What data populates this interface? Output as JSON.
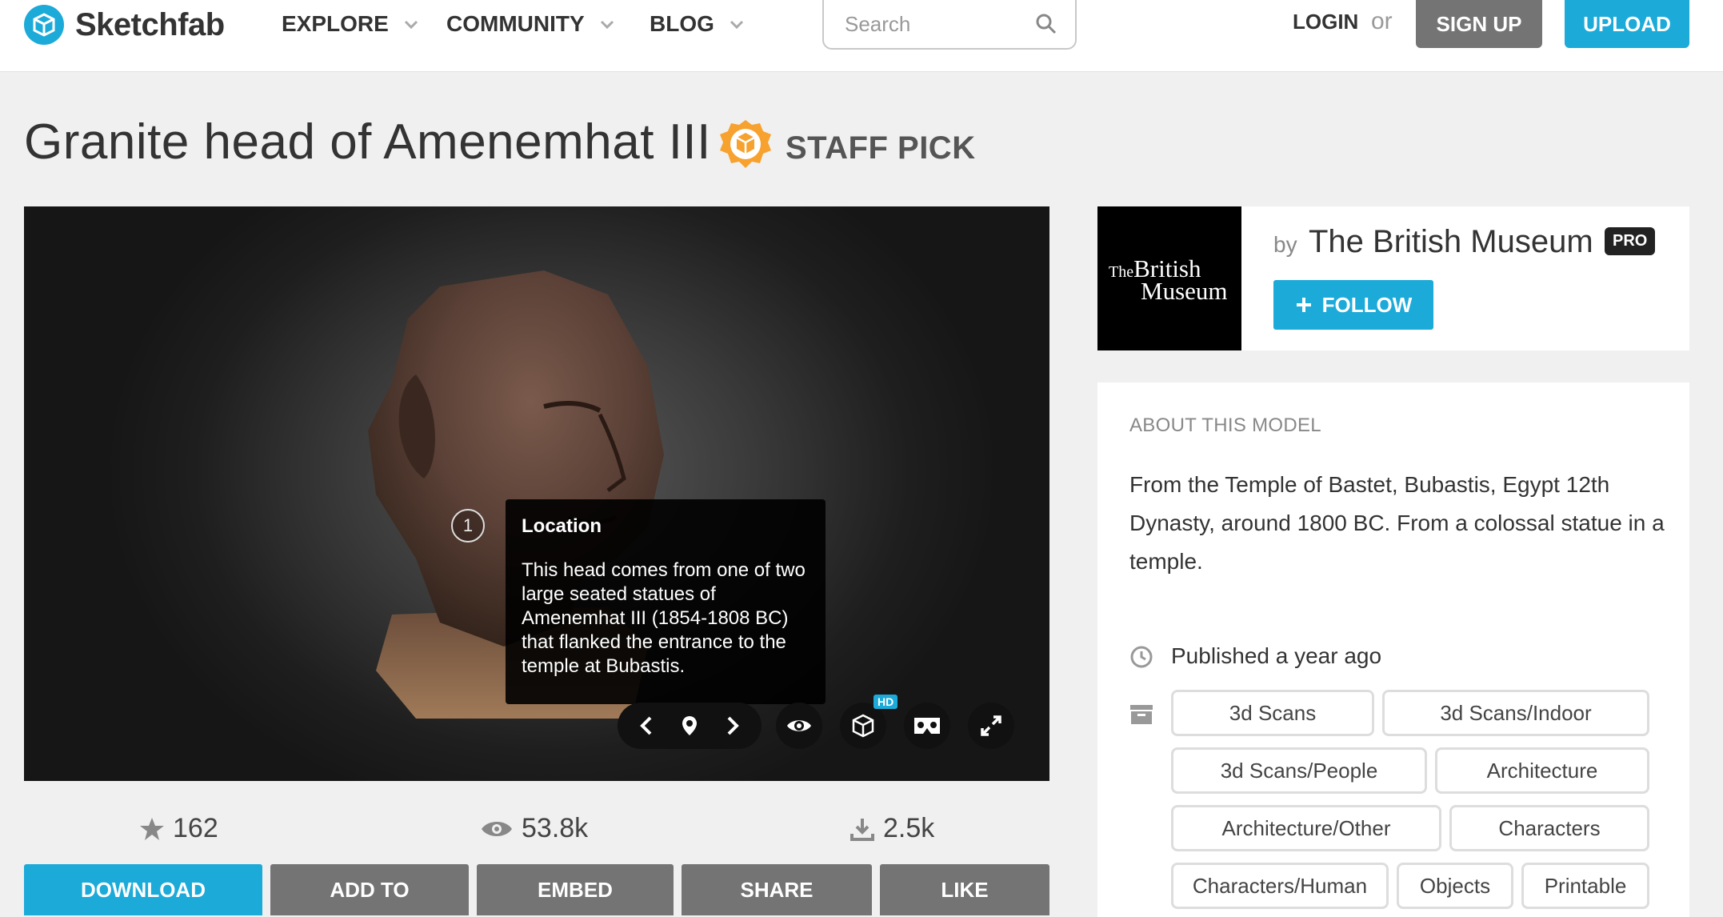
{
  "header": {
    "brand": "Sketchfab",
    "nav": [
      {
        "label": "EXPLORE"
      },
      {
        "label": "COMMUNITY"
      },
      {
        "label": "BLOG"
      }
    ],
    "search_placeholder": "Search",
    "login": "LOGIN",
    "or": "or",
    "signup": "SIGN UP",
    "upload": "UPLOAD"
  },
  "model": {
    "title": "Granite head of Amenemhat III",
    "staff_pick": "STAFF PICK"
  },
  "viewer": {
    "hotspot_number": "1",
    "annotation_title": "Location",
    "annotation_body": "This head comes from one of two large seated statues of Amenemhat III (1854-1808 BC) that flanked the entrance to the temple at Bubastis.",
    "hd_badge": "HD"
  },
  "stats": {
    "likes": "162",
    "views": "53.8k",
    "downloads": "2.5k"
  },
  "actions": {
    "download": "DOWNLOAD",
    "add_to": "ADD TO",
    "embed": "EMBED",
    "share": "SHARE",
    "like": "LIKE"
  },
  "author": {
    "logo_line1_small": "The",
    "logo_line1": "British",
    "logo_line2": "Museum",
    "by": "by",
    "name": "The British Museum",
    "badge": "PRO",
    "follow": "FOLLOW"
  },
  "about": {
    "heading": "ABOUT THIS MODEL",
    "description": "From the Temple of Bastet, Bubastis, Egypt 12th Dynasty, around 1800 BC. From a colossal statue in a temple.",
    "published": "Published a year ago",
    "categories": [
      "3d Scans",
      "3d Scans/Indoor",
      "3d Scans/People",
      "Architecture",
      "Architecture/Other",
      "Characters",
      "Characters/Human",
      "Objects",
      "Printable"
    ]
  },
  "colors": {
    "accent": "#1caad9",
    "signup_gray": "#747474",
    "button_gray": "#747474",
    "staff_pick_orange": "#f7a12e"
  }
}
